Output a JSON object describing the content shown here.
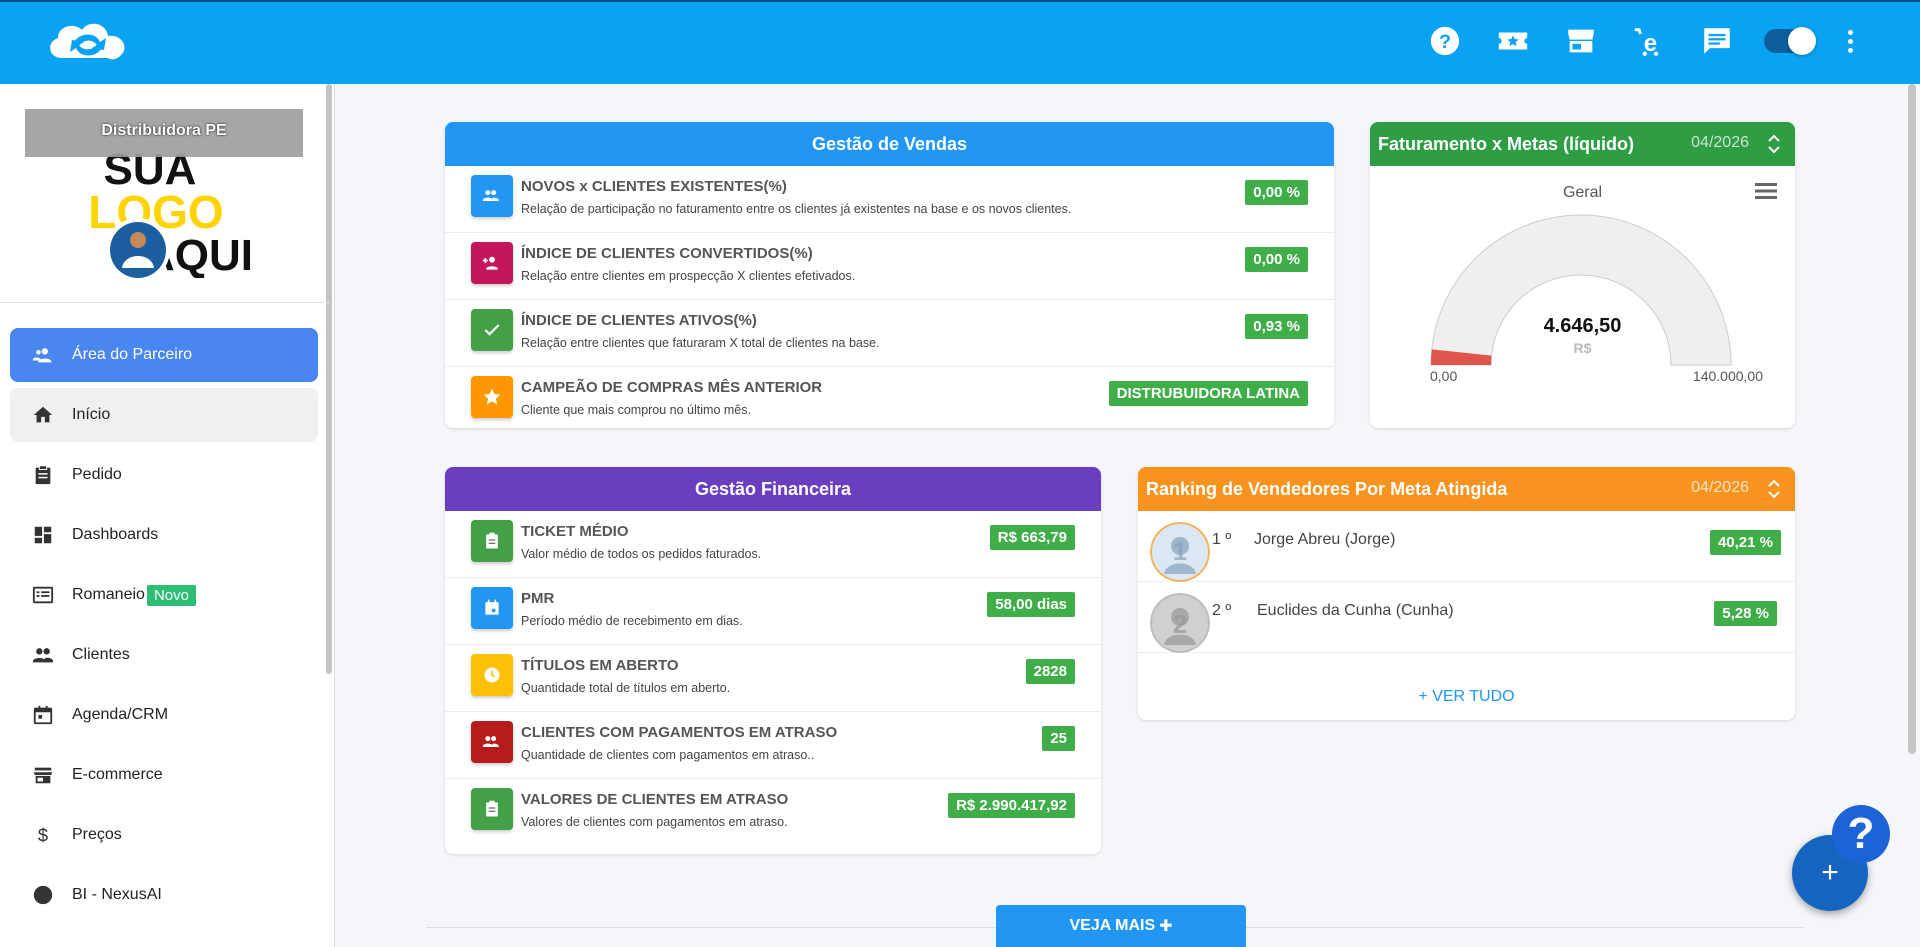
{
  "sidebar": {
    "partner_name": "Distribuidora PE",
    "items": [
      {
        "label": "Área do Parceiro",
        "icon": "person-add-icon"
      },
      {
        "label": "Início",
        "icon": "home-icon"
      },
      {
        "label": "Pedido",
        "icon": "clipboard-icon"
      },
      {
        "label": "Dashboards",
        "icon": "dashboard-icon"
      },
      {
        "label": "Romaneio",
        "icon": "list-card-icon",
        "badge": "Novo"
      },
      {
        "label": "Clientes",
        "icon": "people-icon"
      },
      {
        "label": "Agenda/CRM",
        "icon": "calendar-icon"
      },
      {
        "label": "E-commerce",
        "icon": "store-icon"
      },
      {
        "label": "Preços",
        "icon": "dollar-icon"
      },
      {
        "label": "BI - NexusAI",
        "icon": "circle-icon"
      }
    ]
  },
  "vendas": {
    "title": "Gestão de Vendas",
    "metrics": [
      {
        "title": "NOVOS x CLIENTES EXISTENTES(%)",
        "desc": "Relação de participação no faturamento entre os clientes já existentes na base e os novos clientes.",
        "value": "0,00 %",
        "color": "#2196f3"
      },
      {
        "title": "ÍNDICE DE CLIENTES CONVERTIDOS(%)",
        "desc": "Relação entre clientes em prospecção X clientes efetivados.",
        "value": "0,00 %",
        "color": "#c2185b"
      },
      {
        "title": "ÍNDICE DE CLIENTES ATIVOS(%)",
        "desc": "Relação entre clientes que faturaram X total de clientes na base.",
        "value": "0,93 %",
        "color": "#43a047"
      },
      {
        "title": "CAMPEÃO DE COMPRAS MÊS ANTERIOR",
        "desc": "Cliente que mais comprou no último mês.",
        "value": "DISTRUBUIDORA LATINA",
        "color": "#ff9800"
      }
    ]
  },
  "financeira": {
    "title": "Gestão Financeira",
    "metrics": [
      {
        "title": "TICKET MÉDIO",
        "desc": "Valor médio de todos os pedidos faturados.",
        "value": "R$ 663,79",
        "color": "#43a047"
      },
      {
        "title": "PMR",
        "desc": "Período médio de recebimento em dias.",
        "value": "58,00 dias",
        "color": "#2196f3"
      },
      {
        "title": "TÍTULOS EM ABERTO",
        "desc": "Quantidade total de títulos em aberto.",
        "value": "2828",
        "color": "#ffc107"
      },
      {
        "title": "CLIENTES COM PAGAMENTOS EM ATRASO",
        "desc": "Quantidade de clientes com pagamentos em atraso..",
        "value": "25",
        "color": "#b71c1c"
      },
      {
        "title": "VALORES DE CLIENTES EM ATRASO",
        "desc": "Valores de clientes com pagamentos em atraso.",
        "value": "R$ 2.990.417,92",
        "color": "#43a047"
      }
    ]
  },
  "faturamento": {
    "title": "Faturamento x Metas (líquido)",
    "date": "04/2026",
    "gauge_label": "Geral",
    "value": "4.646,50",
    "unit": "R$",
    "min": "0,00",
    "max": "140.000,00",
    "fraction": 0.0332
  },
  "ranking": {
    "title": "Ranking de Vendedores Por Meta Atingida",
    "date": "04/2026",
    "rows": [
      {
        "pos": "1 º",
        "name": "Jorge Abreu (Jorge)",
        "value": "40,21 %"
      },
      {
        "pos": "2 º",
        "name": "Euclides da Cunha (Cunha)",
        "value": "5,28 %"
      }
    ],
    "see_all": "+  VER TUDO"
  },
  "veja_mais": "VEJA MAIS",
  "fab_help": "?",
  "fab_add": "+"
}
